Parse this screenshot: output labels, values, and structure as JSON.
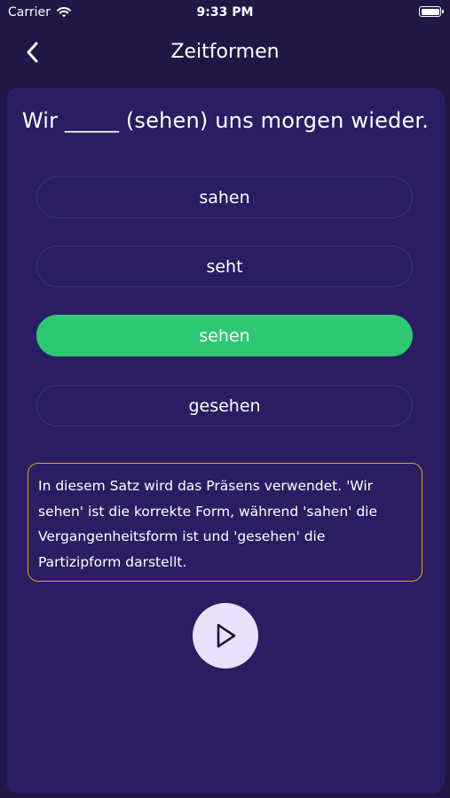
{
  "status_bar": {
    "carrier": "Carrier",
    "time": "9:33 PM"
  },
  "nav": {
    "title": "Zeitformen",
    "back_icon": "chevron-left-icon"
  },
  "quiz": {
    "question": "Wir _____ (sehen) uns morgen wieder.",
    "options": [
      {
        "label": "sahen",
        "selected": false
      },
      {
        "label": "seht",
        "selected": false
      },
      {
        "label": "sehen",
        "selected": true
      },
      {
        "label": "gesehen",
        "selected": false
      }
    ],
    "explanation": "In diesem Satz wird das Präsens verwendet. 'Wir sehen' ist die korrekte Form, während 'sahen' die Vergangenheitsform ist und 'gesehen' die Partizipform darstellt.",
    "play_icon": "play-icon"
  },
  "colors": {
    "background": "#201746",
    "card": "#2b1d62",
    "correct": "#2ec872",
    "explanation_border": "#d9a22b",
    "option_border": "#3d3177",
    "play_button": "#eae1fa"
  }
}
